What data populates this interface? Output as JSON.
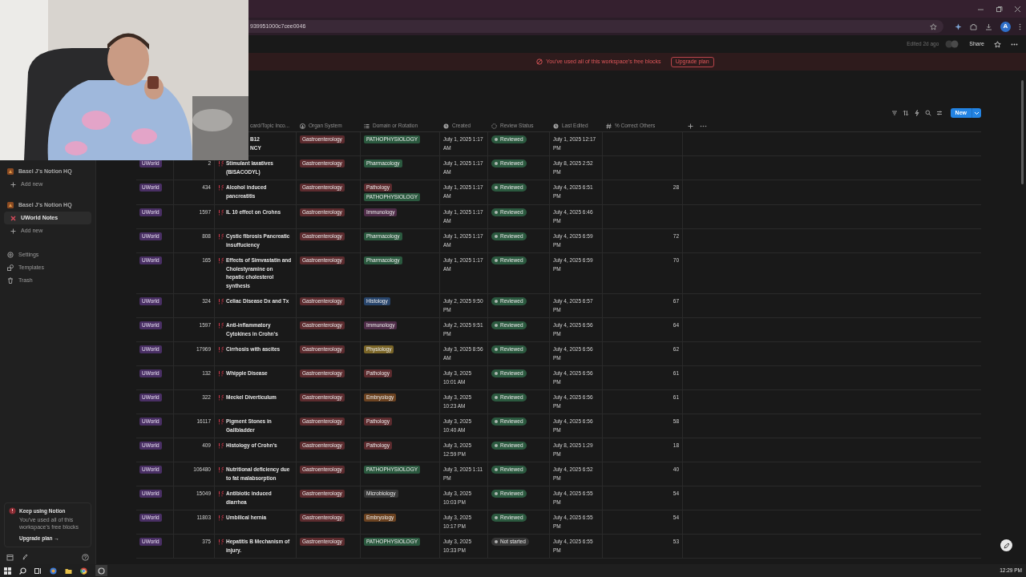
{
  "browser": {
    "url": "939951000c7cee0046",
    "avatar": "A"
  },
  "topbar": {
    "edited": "Edited 2d ago",
    "share": "Share"
  },
  "banner": {
    "message": "You've used all of this workspace's free blocks",
    "button": "Upgrade plan"
  },
  "sidebar": {
    "items": [
      {
        "kind": "workspace",
        "label": "Basel J's Notion HQ",
        "selected": false
      },
      {
        "kind": "add",
        "label": "Add new",
        "selected": false
      },
      {
        "kind": "workspace",
        "label": "Basel J's Notion HQ",
        "selected": false
      },
      {
        "kind": "page",
        "label": "UWorld Notes",
        "selected": true
      },
      {
        "kind": "add",
        "label": "Add new",
        "selected": false
      },
      {
        "kind": "settings",
        "label": "Settings",
        "selected": false
      },
      {
        "kind": "templates",
        "label": "Templates",
        "selected": false
      },
      {
        "kind": "trash",
        "label": "Trash",
        "selected": false
      }
    ],
    "upgrade_card": {
      "title": "Keep using Notion",
      "text": "You've used all of this workspace's free blocks",
      "link": "Upgrade plan →"
    }
  },
  "toolbar": {
    "new_button": "New"
  },
  "table": {
    "columns": [
      "card/Topic Inco...",
      "Organ System",
      "Domain or Rotation",
      "Created",
      "Review Status",
      "Last Edited",
      "% Correct Others"
    ],
    "rows": [
      {
        "title": "B12\nNCY",
        "organ": {
          "label": "Gastroenterology",
          "color": "#5c2b2e"
        },
        "domains": [
          {
            "label": "PATHOPHYSIOLOGY",
            "color": "#2b593f"
          }
        ],
        "created": "July 1, 2025 1:17 AM",
        "status": {
          "label": "Reviewed",
          "color": "#2b593f"
        },
        "last_edited": "July 1, 2025 12:17 PM"
      },
      {
        "source": "UWorld",
        "number": "2",
        "title": "Stimulant laxatives (BISACODYL)",
        "organ": {
          "label": "Gastroenterology",
          "color": "#5c2b2e"
        },
        "domains": [
          {
            "label": "Pharmacology",
            "color": "#2b593f"
          }
        ],
        "created": "July 1, 2025 1:17 AM",
        "status": {
          "label": "Reviewed",
          "color": "#2b593f"
        },
        "last_edited": "July 8, 2025 2:52 PM"
      },
      {
        "source": "UWorld",
        "number": "434",
        "title": "Alcohol induced pancreatitis",
        "organ": {
          "label": "Gastroenterology",
          "color": "#5c2b2e"
        },
        "domains": [
          {
            "label": "Pathology",
            "color": "#5c2b2e"
          },
          {
            "label": "PATHOPHYSIOLOGY",
            "color": "#2b593f"
          }
        ],
        "created": "July 1, 2025 1:17 AM",
        "status": {
          "label": "Reviewed",
          "color": "#2b593f"
        },
        "last_edited": "July 4, 2025 6:51 PM",
        "percent": "28"
      },
      {
        "source": "UWorld",
        "number": "1597",
        "title": "IL 10 effect on Crohns",
        "organ": {
          "label": "Gastroenterology",
          "color": "#5c2b2e"
        },
        "domains": [
          {
            "label": "Immunology",
            "color": "#4e2c48"
          }
        ],
        "created": "July 1, 2025 1:17 AM",
        "status": {
          "label": "Reviewed",
          "color": "#2b593f"
        },
        "last_edited": "July 4, 2025 6:46 PM"
      },
      {
        "source": "UWorld",
        "number": "808",
        "title": "Cystic fibrosis Pancreatic insuffuciency",
        "organ": {
          "label": "Gastroenterology",
          "color": "#5c2b2e"
        },
        "domains": [
          {
            "label": "Pharmacology",
            "color": "#2b593f"
          }
        ],
        "created": "July 1, 2025 1:17 AM",
        "status": {
          "label": "Reviewed",
          "color": "#2b593f"
        },
        "last_edited": "July 4, 2025 6:59 PM",
        "percent": "72"
      },
      {
        "source": "UWorld",
        "number": "165",
        "title": "Effects of Simvastatin and Cholestyramine on hepatic cholesterol synthesis",
        "organ": {
          "label": "Gastroenterology",
          "color": "#5c2b2e"
        },
        "domains": [
          {
            "label": "Pharmacology",
            "color": "#2b593f"
          }
        ],
        "created": "July 1, 2025 1:17 AM",
        "status": {
          "label": "Reviewed",
          "color": "#2b593f"
        },
        "last_edited": "July 4, 2025 6:59 PM",
        "percent": "70"
      },
      {
        "source": "UWorld",
        "number": "324",
        "title": "Celiac Disease Dx and Tx",
        "organ": {
          "label": "Gastroenterology",
          "color": "#5c2b2e"
        },
        "domains": [
          {
            "label": "Histology",
            "color": "#28456c"
          }
        ],
        "created": "July 2, 2025 9:50 PM",
        "status": {
          "label": "Reviewed",
          "color": "#2b593f"
        },
        "last_edited": "July 4, 2025 6:57 PM",
        "percent": "67"
      },
      {
        "source": "UWorld",
        "number": "1597",
        "title": "Anti-inflammatory Cytokines in Crohn's",
        "organ": {
          "label": "Gastroenterology",
          "color": "#5c2b2e"
        },
        "domains": [
          {
            "label": "Immunology",
            "color": "#4e2c48"
          }
        ],
        "created": "July 2, 2025 9:51 PM",
        "status": {
          "label": "Reviewed",
          "color": "#2b593f"
        },
        "last_edited": "July 4, 2025 6:56 PM",
        "percent": "64"
      },
      {
        "source": "UWorld",
        "number": "17969",
        "title": "Cirrhosis with ascites",
        "organ": {
          "label": "Gastroenterology",
          "color": "#5c2b2e"
        },
        "domains": [
          {
            "label": "Physiology",
            "color": "#7a6527"
          }
        ],
        "created": "July 3, 2025 8:56 AM",
        "status": {
          "label": "Reviewed",
          "color": "#2b593f"
        },
        "last_edited": "July 4, 2025 6:56 PM",
        "percent": "62"
      },
      {
        "source": "UWorld",
        "number": "132",
        "title": "Whipple Disease",
        "organ": {
          "label": "Gastroenterology",
          "color": "#5c2b2e"
        },
        "domains": [
          {
            "label": "Pathology",
            "color": "#5c2b2e"
          }
        ],
        "created": "July 3, 2025 10:01 AM",
        "status": {
          "label": "Reviewed",
          "color": "#2b593f"
        },
        "last_edited": "July 4, 2025 6:56 PM",
        "percent": "61"
      },
      {
        "source": "UWorld",
        "number": "322",
        "title": "Meckel Diverticulum",
        "organ": {
          "label": "Gastroenterology",
          "color": "#5c2b2e"
        },
        "domains": [
          {
            "label": "Embryology",
            "color": "#6b4220"
          }
        ],
        "created": "July 3, 2025 10:23 AM",
        "status": {
          "label": "Reviewed",
          "color": "#2b593f"
        },
        "last_edited": "July 4, 2025 6:56 PM",
        "percent": "61"
      },
      {
        "source": "UWorld",
        "number": "16117",
        "title": "Pigment Stones in Gallbladder",
        "organ": {
          "label": "Gastroenterology",
          "color": "#5c2b2e"
        },
        "domains": [
          {
            "label": "Pathology",
            "color": "#5c2b2e"
          }
        ],
        "created": "July 3, 2025 10:40 AM",
        "status": {
          "label": "Reviewed",
          "color": "#2b593f"
        },
        "last_edited": "July 4, 2025 6:56 PM",
        "percent": "58"
      },
      {
        "source": "UWorld",
        "number": "409",
        "title": "Histology of Crohn's",
        "organ": {
          "label": "Gastroenterology",
          "color": "#5c2b2e"
        },
        "domains": [
          {
            "label": "Pathology",
            "color": "#5c2b2e"
          }
        ],
        "created": "July 3, 2025 12:59 PM",
        "status": {
          "label": "Reviewed",
          "color": "#2b593f"
        },
        "last_edited": "July 8, 2025 1:29 PM",
        "percent": "18"
      },
      {
        "source": "UWorld",
        "number": "106480",
        "title": "Nutritional deficiency due to fat malabsorption",
        "organ": {
          "label": "Gastroenterology",
          "color": "#5c2b2e"
        },
        "domains": [
          {
            "label": "PATHOPHYSIOLOGY",
            "color": "#2b593f"
          }
        ],
        "created": "July 3, 2025 1:11 PM",
        "status": {
          "label": "Reviewed",
          "color": "#2b593f"
        },
        "last_edited": "July 4, 2025 6:52 PM",
        "percent": "40"
      },
      {
        "source": "UWorld",
        "number": "15049",
        "title": "Antibiotic induced diarrhea",
        "organ": {
          "label": "Gastroenterology",
          "color": "#5c2b2e"
        },
        "domains": [
          {
            "label": "Microbiology",
            "color": "#373737"
          }
        ],
        "created": "July 3, 2025 10:03 PM",
        "status": {
          "label": "Reviewed",
          "color": "#2b593f"
        },
        "last_edited": "July 4, 2025 6:55 PM",
        "percent": "54"
      },
      {
        "source": "UWorld",
        "number": "11803",
        "title": "Umbilical hernia",
        "organ": {
          "label": "Gastroenterology",
          "color": "#5c2b2e"
        },
        "domains": [
          {
            "label": "Embryology",
            "color": "#6b4220"
          }
        ],
        "created": "July 3, 2025 10:17 PM",
        "status": {
          "label": "Reviewed",
          "color": "#2b593f"
        },
        "last_edited": "July 4, 2025 6:55 PM",
        "percent": "54"
      },
      {
        "source": "UWorld",
        "number": "375",
        "title": "Hepatitis B Mechanism of injury.",
        "organ": {
          "label": "Gastroenterology",
          "color": "#5c2b2e"
        },
        "domains": [
          {
            "label": "PATHOPHYSIOLOGY",
            "color": "#2b593f"
          }
        ],
        "created": "July 3, 2025 10:33 PM",
        "status": {
          "label": "Not started",
          "color": "#373737"
        },
        "last_edited": "July 4, 2025 6:55 PM",
        "percent": "53"
      }
    ]
  },
  "taskbar": {
    "time": "12:29 PM"
  }
}
